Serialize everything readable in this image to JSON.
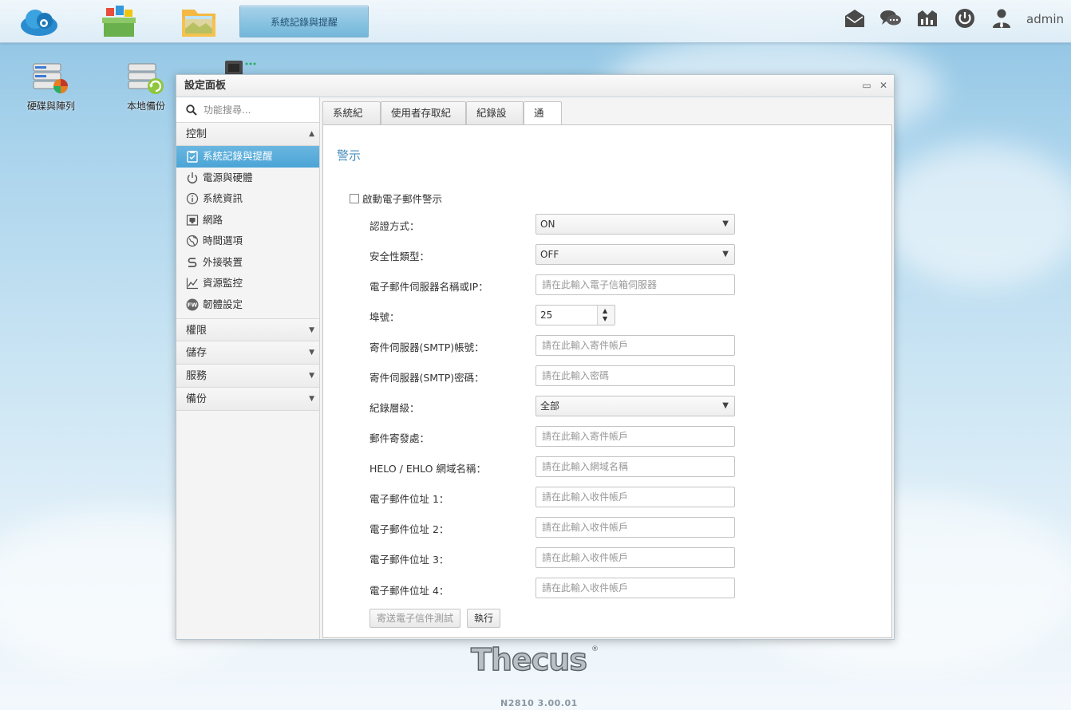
{
  "taskbar": {
    "active_task": "系統記錄與提醒",
    "user": "admin"
  },
  "desktop": {
    "icons": [
      {
        "label": "硬碟與陣列"
      },
      {
        "label": "本地備份"
      }
    ]
  },
  "window": {
    "title": "設定面板"
  },
  "sidebar": {
    "search_placeholder": "功能搜尋...",
    "sections": [
      {
        "label": "控制",
        "expanded": true
      },
      {
        "label": "權限"
      },
      {
        "label": "儲存"
      },
      {
        "label": "服務"
      },
      {
        "label": "備份"
      }
    ],
    "control_items": [
      {
        "label": "系統記錄與提醒",
        "icon": "clipboard-check-icon",
        "active": true
      },
      {
        "label": "電源與硬體",
        "icon": "power-icon"
      },
      {
        "label": "系統資訊",
        "icon": "info-icon"
      },
      {
        "label": "網路",
        "icon": "network-icon"
      },
      {
        "label": "時間選項",
        "icon": "globe-icon"
      },
      {
        "label": "外接裝置",
        "icon": "usb-icon"
      },
      {
        "label": "資源監控",
        "icon": "line-chart-icon"
      },
      {
        "label": "韌體設定",
        "icon": "firmware-icon"
      }
    ]
  },
  "tabs": [
    {
      "label": "系統紀錄"
    },
    {
      "label": "使用者存取紀錄"
    },
    {
      "label": "紀錄設定"
    },
    {
      "label": "通知",
      "active": true
    }
  ],
  "panel": {
    "title": "警示",
    "enable_checkbox_label": "啟動電子郵件警示",
    "fields": {
      "auth_method": {
        "label": "認證方式：",
        "value": "ON"
      },
      "security_type": {
        "label": "安全性類型：",
        "value": "OFF"
      },
      "smtp_server": {
        "label": "電子郵件伺服器名稱或IP：",
        "placeholder": "請在此輸入電子信箱伺服器"
      },
      "port": {
        "label": "埠號：",
        "value": "25"
      },
      "smtp_account": {
        "label": "寄件伺服器(SMTP)帳號：",
        "placeholder": "請在此輸入寄件帳戶"
      },
      "smtp_password": {
        "label": "寄件伺服器(SMTP)密碼：",
        "placeholder": "請在此輸入密碼"
      },
      "log_level": {
        "label": "紀錄層級：",
        "value": "全部"
      },
      "sender": {
        "label": "郵件寄發處：",
        "placeholder": "請在此輸入寄件帳戶"
      },
      "helo": {
        "label": "HELO / EHLO 網域名稱：",
        "placeholder": "請在此輸入網域名稱"
      },
      "email1": {
        "label": "電子郵件位址 1：",
        "placeholder": "請在此輸入收件帳戶"
      },
      "email2": {
        "label": "電子郵件位址 2：",
        "placeholder": "請在此輸入收件帳戶"
      },
      "email3": {
        "label": "電子郵件位址 3：",
        "placeholder": "請在此輸入收件帳戶"
      },
      "email4": {
        "label": "電子郵件位址 4：",
        "placeholder": "請在此輸入收件帳戶"
      }
    },
    "test_button": "寄送電子信件測試",
    "execute_button": "執行"
  },
  "footer": {
    "brand": "Thecus",
    "version": "N2810   3.00.01"
  },
  "colors": {
    "accent": "#4aa4d6",
    "title_blue": "#4a8fbd"
  }
}
